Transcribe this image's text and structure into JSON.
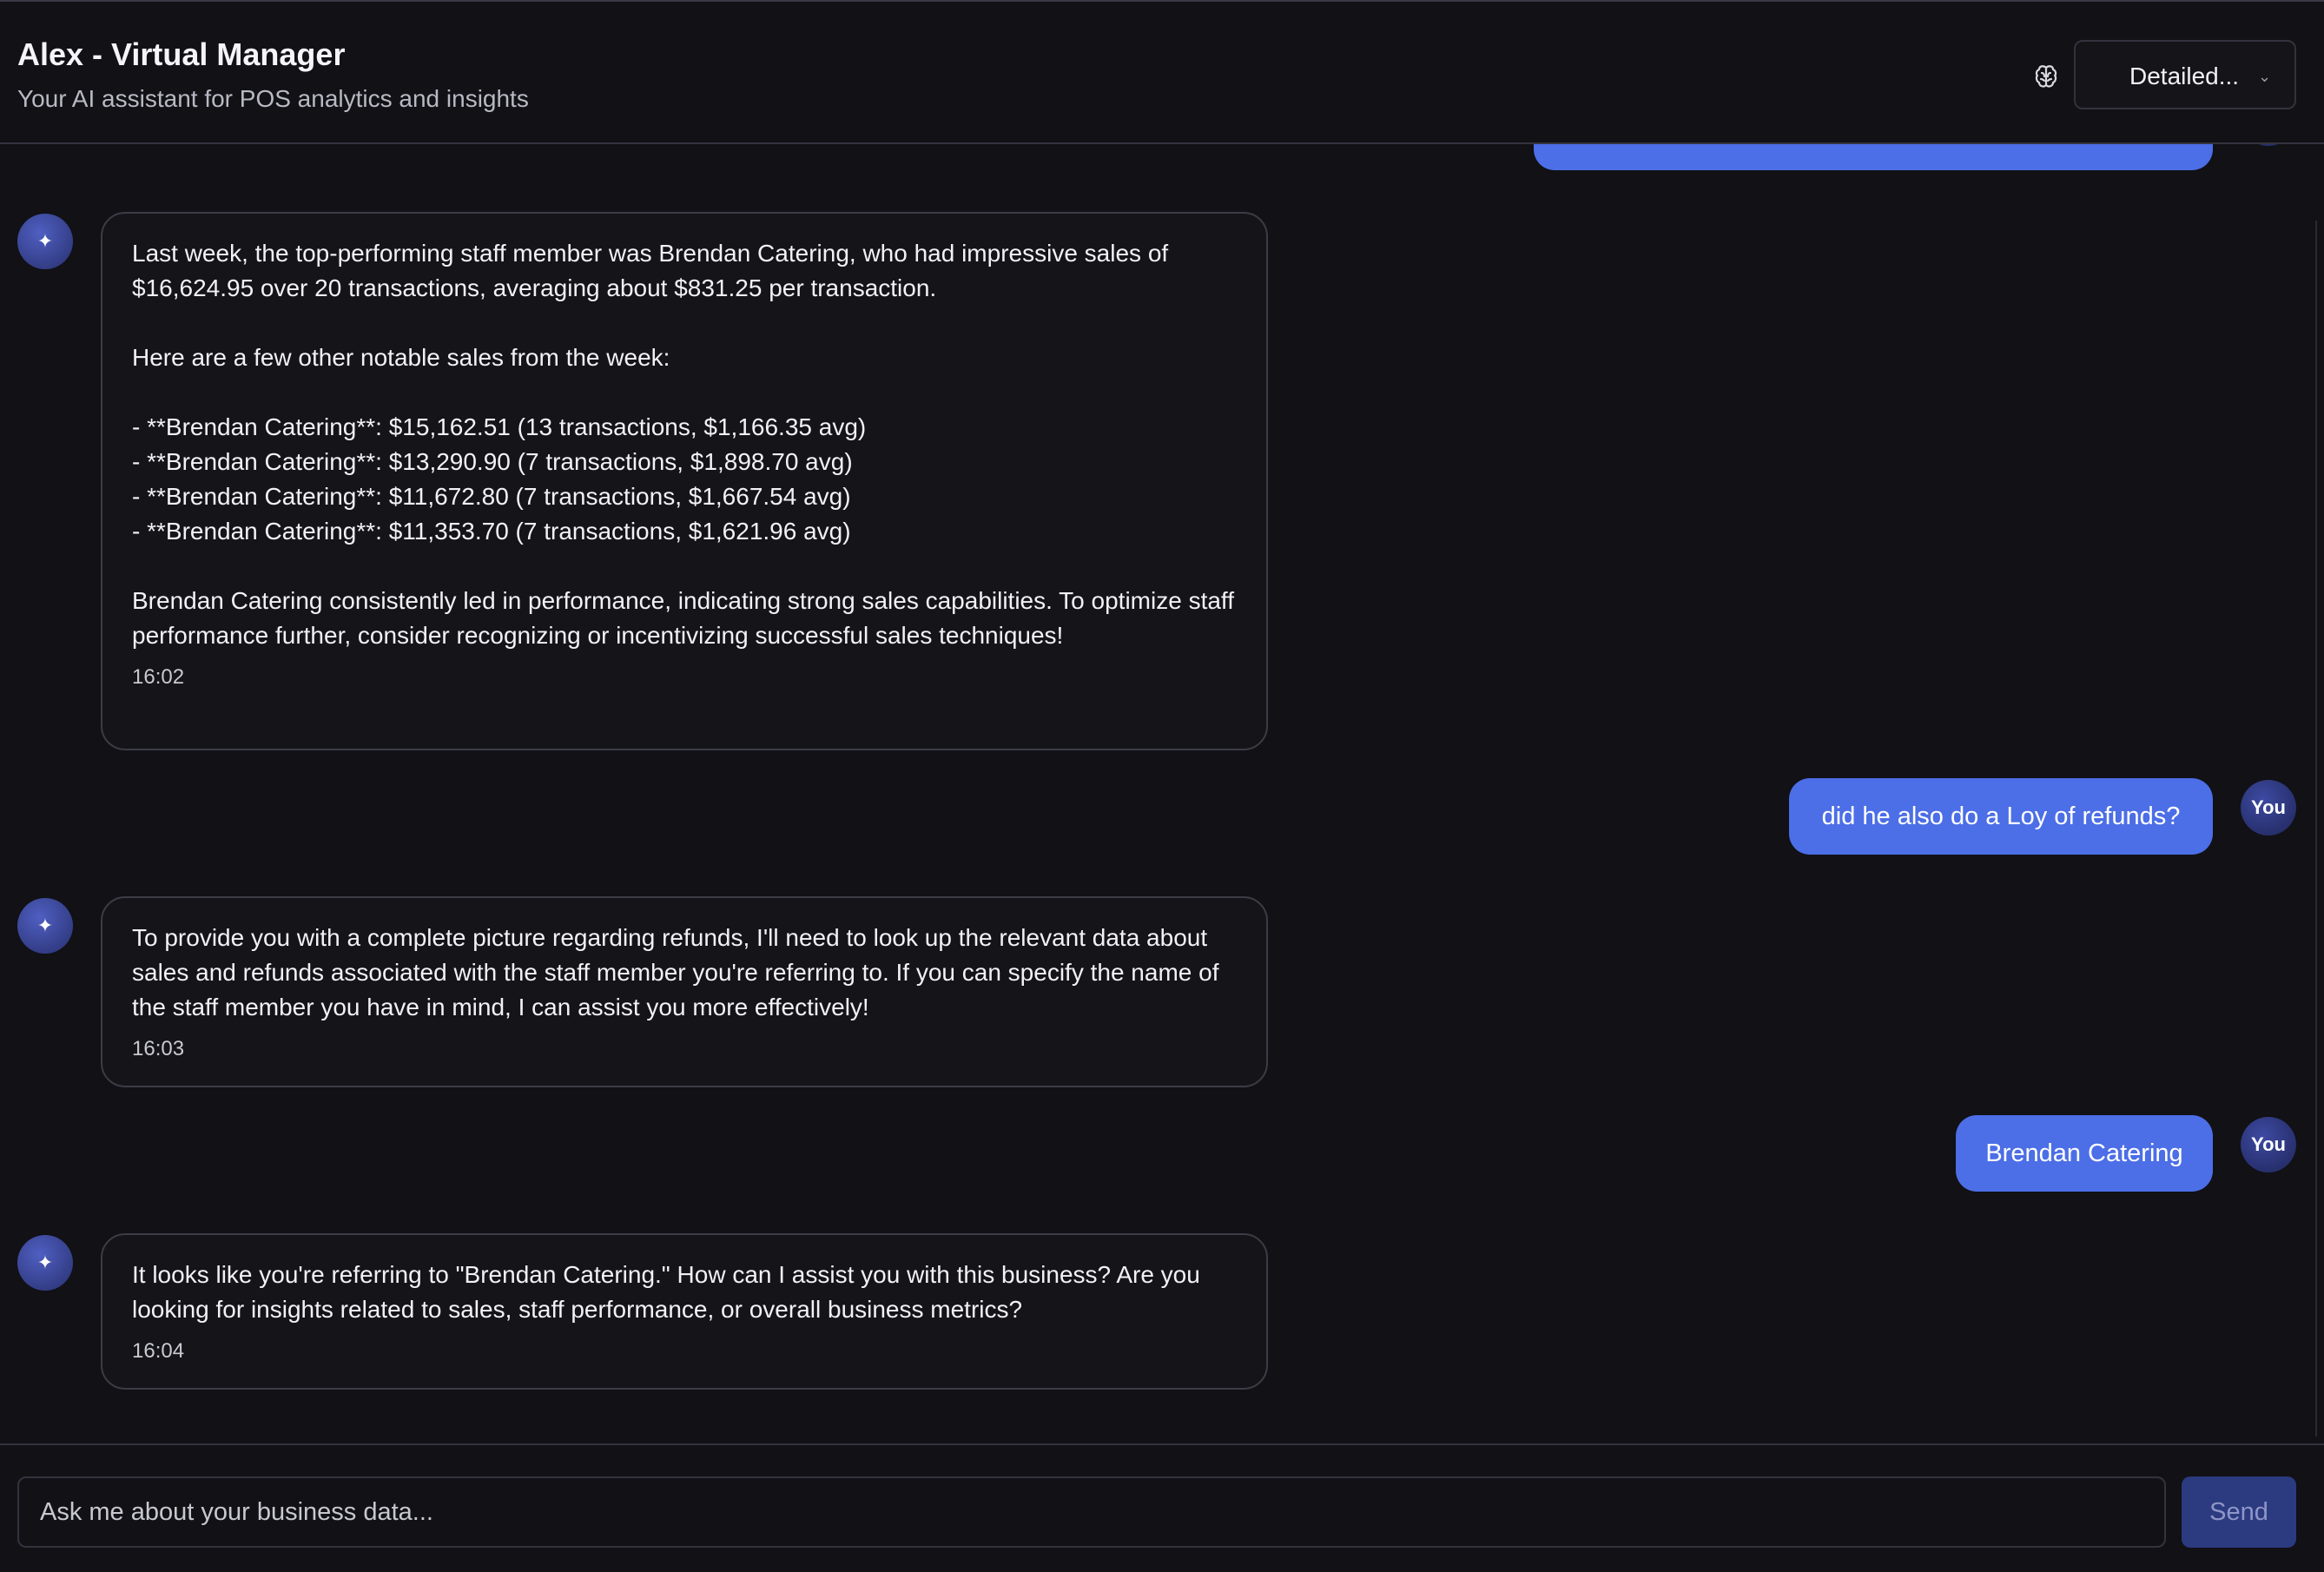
{
  "header": {
    "title": "Alex - Virtual Manager",
    "subtitle": "Your AI assistant for POS analytics and insights",
    "brain_icon": "brain-icon",
    "mode_select": {
      "value": "Detailed...",
      "icon": "chevron-down-icon"
    }
  },
  "messages": [
    {
      "role": "assistant",
      "text": "Last week, the top-performing staff member was Brendan Catering, who had impressive sales of $16,624.95 over 20 transactions, averaging about $831.25 per transaction.\n\nHere are a few other notable sales from the week:\n\n- **Brendan Catering**: $15,162.51 (13 transactions, $1,166.35 avg)\n- **Brendan Catering**: $13,290.90 (7 transactions, $1,898.70 avg)\n- **Brendan Catering**: $11,672.80 (7 transactions, $1,667.54 avg)\n- **Brendan Catering**: $11,353.70 (7 transactions, $1,621.96 avg)\n\nBrendan Catering consistently led in performance, indicating strong sales capabilities. To optimize staff performance further, consider recognizing or incentivizing successful sales techniques!",
      "time": "16:02"
    },
    {
      "role": "user",
      "text": "did he also do a Loy of refunds?",
      "avatar": "You"
    },
    {
      "role": "assistant",
      "text": "To provide you with a complete picture regarding refunds, I'll need to look up the relevant data about sales and refunds associated with the staff member you're referring to. If you can specify the name of the staff member you have in mind, I can assist you more effectively!",
      "time": "16:03"
    },
    {
      "role": "user",
      "text": "Brendan Catering",
      "avatar": "You"
    },
    {
      "role": "assistant",
      "text": "It looks like you're referring to \"Brendan Catering.\" How can I assist you with this business? Are you looking for insights related to sales, staff performance, or overall business metrics?",
      "time": "16:04"
    }
  ],
  "assistant_avatar_icon": "sparkle-icon",
  "composer": {
    "placeholder": "Ask me about your business data...",
    "send_label": "Send"
  },
  "colors": {
    "background": "#111116",
    "user_bubble": "#4c6ee6",
    "send_button": "#2c3a80",
    "border": "#3c3c46"
  }
}
